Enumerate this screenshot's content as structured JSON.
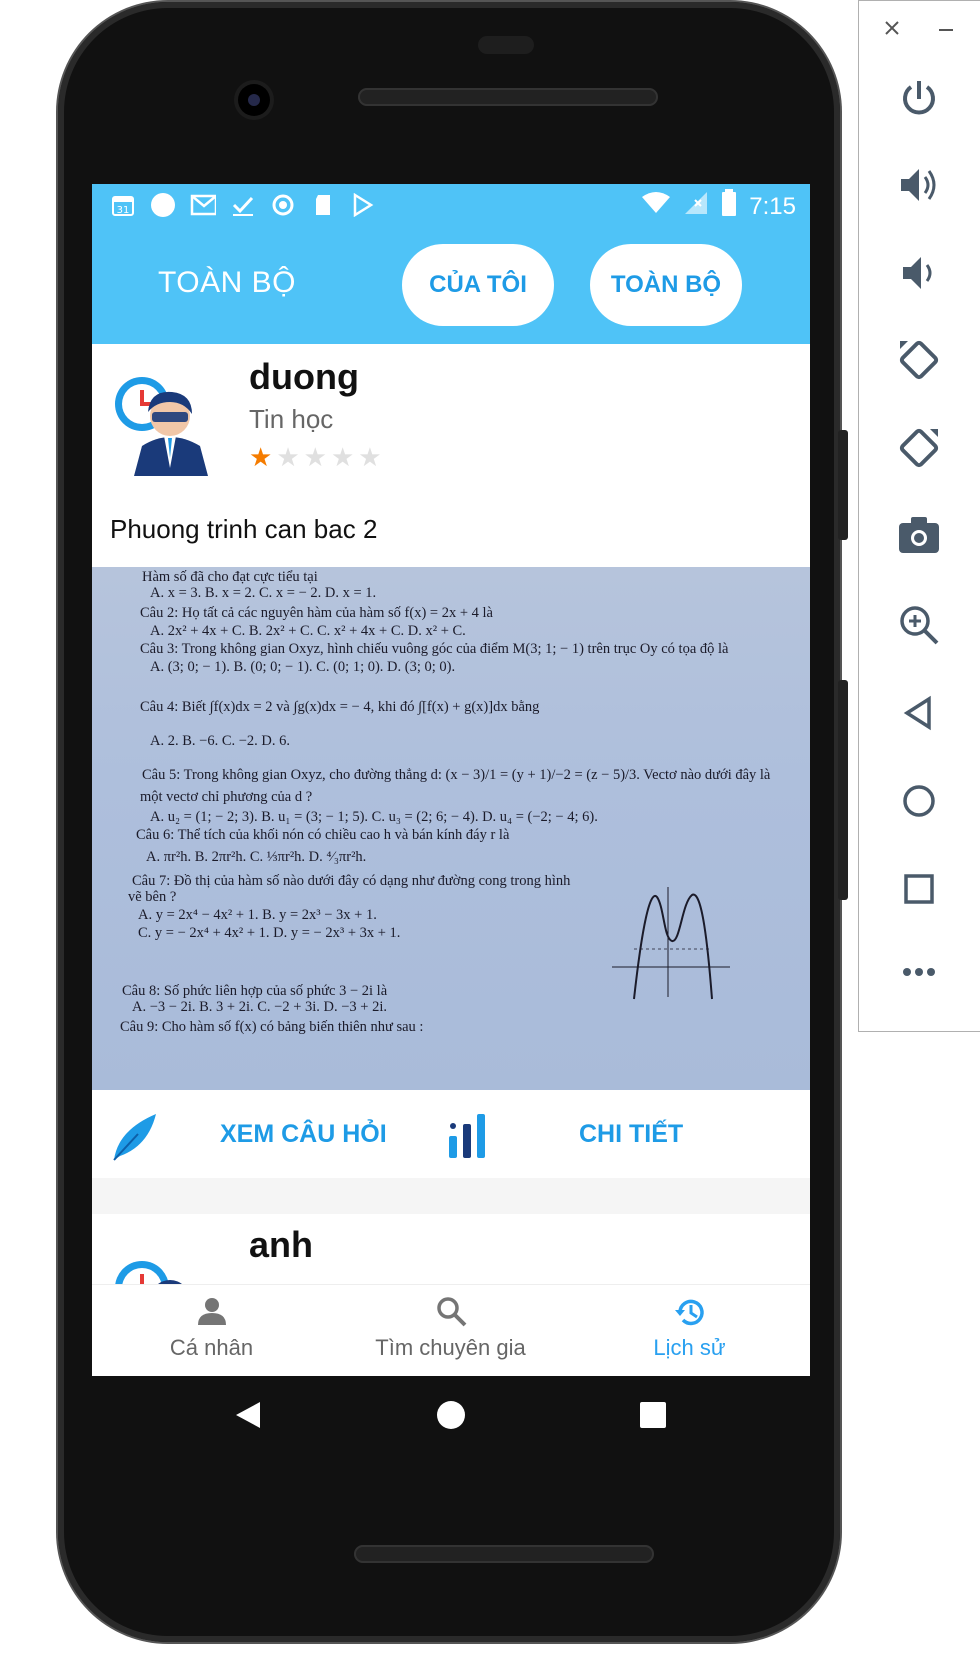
{
  "status_bar": {
    "time": "7:15",
    "calendar_day": "31"
  },
  "app_bar": {
    "title": "TOÀN BỘ",
    "filter_mine": "CỦA TÔI",
    "filter_all": "TOÀN BỘ"
  },
  "posts": [
    {
      "author": "duong",
      "subject": "Tin học",
      "rating": 1,
      "rating_max": 5,
      "question": "Phuong trinh can bac 2",
      "image_lines": [
        "Hàm số đã cho đạt cực tiểu tại",
        "A. x = 3.            B. x = 2.            C. x = − 2.            D. x = 1.",
        "Câu 2: Họ tất cả các nguyên hàm của hàm số f(x) = 2x + 4 là",
        "A. 2x² + 4x + C.      B. 2x² + C.      C. x² + 4x + C.      D. x² + C.",
        "Câu 3: Trong không gian Oxyz, hình chiếu vuông góc của điểm M(3; 1; − 1) trên trục Oy có tọa độ là",
        "A. (3; 0; − 1).       B. (0; 0; − 1).       C. (0; 1; 0).       D. (3; 0; 0).",
        "Câu 4: Biết ∫f(x)dx = 2 và ∫g(x)dx = − 4, khi đó ∫[f(x) + g(x)]dx bằng",
        "A. 2.               B. −6.               C. −2.               D. 6.",
        "Câu 5: Trong không gian Oxyz, cho đường thẳng d: (x − 3)/1 = (y + 1)/−2 = (z − 5)/3. Vectơ nào dưới đây là",
        "một vectơ chỉ phương của d ?",
        "A. u₂ = (1; − 2; 3).   B. u₁ = (3; − 1; 5).   C. u₃ = (2; 6; − 4).   D. u₄ = (−2; − 4; 6).",
        "Câu 6: Thể tích của khối nón có chiều cao h và bán kính đáy r là",
        "A. πr²h.             B. 2πr²h.             C. ⅓πr²h.             D. ⁴⁄₃πr²h.",
        "Câu 7: Đồ thị của hàm số nào dưới đây có dạng như đường cong trong hình",
        "vẽ bên ?",
        "A. y = 2x⁴ − 4x² + 1.       B. y = 2x³ − 3x + 1.",
        "C. y = − 2x⁴ + 4x² + 1.     D. y = − 2x³ + 3x + 1.",
        "Câu 8: Số phức liên hợp của số phức 3 − 2i là",
        "A. −3 − 2i.          B. 3 + 2i.          C. −2 + 3i.          D. −3 + 2i.",
        "Câu 9: Cho hàm số f(x) có bảng biến thiên như sau :"
      ],
      "action_view": "XEM CÂU HỎI",
      "action_detail": "CHI TIẾT"
    },
    {
      "author": "anh"
    }
  ],
  "bottom_nav": {
    "personal": "Cá nhân",
    "find_expert": "Tìm chuyên gia",
    "history": "Lịch sử",
    "active": "history"
  },
  "colors": {
    "primary": "#4fc3f7",
    "accent_text": "#1e9be6",
    "star_on": "#f57c00",
    "star_off": "#e0e0e0"
  }
}
